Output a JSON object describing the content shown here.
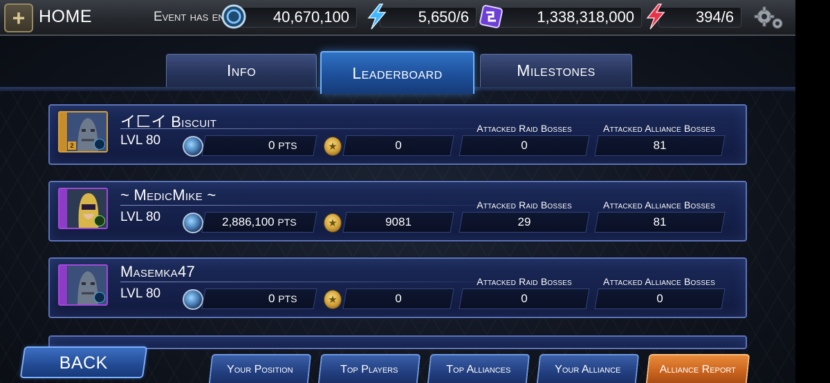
{
  "topbar": {
    "home_label": "HOME",
    "event_status": "Event has ended",
    "resources": [
      {
        "name": "credits",
        "icon": "credits-icon",
        "value": "40,670,100"
      },
      {
        "name": "energy",
        "icon": "energy-bolt-icon",
        "value": "5,650/6"
      },
      {
        "name": "gear-currency",
        "icon": "gear-chip-icon",
        "value": "1,338,318,000"
      },
      {
        "name": "pvp-energy",
        "icon": "red-bolt-icon",
        "value": "394/6"
      }
    ]
  },
  "tabs": [
    {
      "label": "Info",
      "active": false
    },
    {
      "label": "Leaderboard",
      "active": true
    },
    {
      "label": "Milestones",
      "active": false
    }
  ],
  "stat_labels": {
    "raid": "Attacked Raid Bosses",
    "alliance": "Attacked Alliance Bosses"
  },
  "players": [
    {
      "name": "イ匚イ Biscuit",
      "level": "LVL 80",
      "points": "0",
      "pts_unit": "PTS",
      "medals": "0",
      "raid": "0",
      "alliance": "81",
      "rank_badge": "2"
    },
    {
      "name": "~ MedicMike ~",
      "level": "LVL 80",
      "points": "2,886,100",
      "pts_unit": "PTS",
      "medals": "9081",
      "raid": "29",
      "alliance": "81"
    },
    {
      "name": "Masemka47",
      "level": "LVL 80",
      "points": "0",
      "pts_unit": "PTS",
      "medals": "0",
      "raid": "0",
      "alliance": "0"
    }
  ],
  "bottom": {
    "back": "BACK",
    "nav": [
      {
        "label": "Your Position"
      },
      {
        "label": "Top Players"
      },
      {
        "label": "Top Alliances"
      },
      {
        "label": "Your Alliance"
      },
      {
        "label": "Alliance Report",
        "active": true
      }
    ]
  },
  "colors": {
    "active_tab": "#1d4f9a",
    "card_border": "#5e74b6",
    "alliance_report": "#c9631d"
  }
}
